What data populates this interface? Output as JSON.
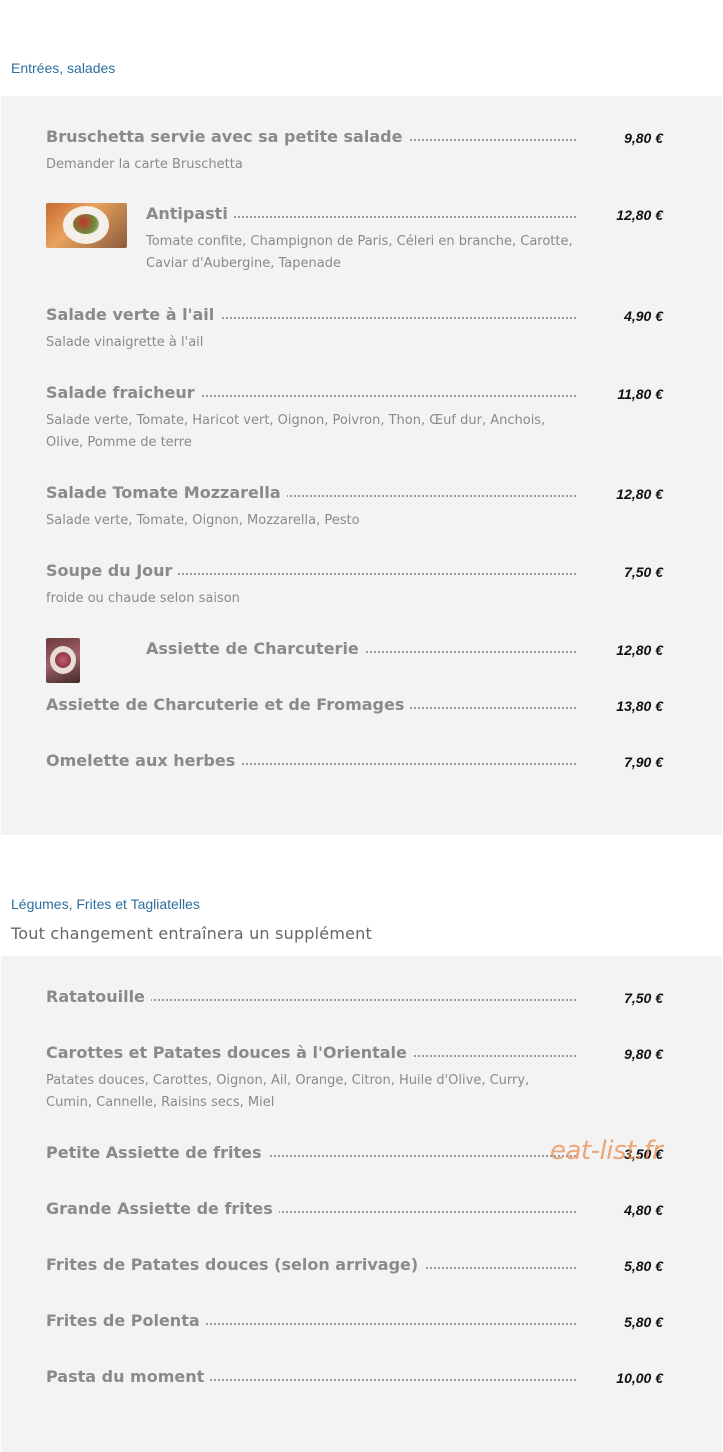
{
  "sections": [
    {
      "title": "Entrées, salades",
      "items": [
        {
          "name": "Bruschetta servie avec sa petite salade",
          "price": "9,80 €",
          "desc": "Demander la carte Bruschetta"
        },
        {
          "name": "Antipasti",
          "price": "12,80 €",
          "desc": "Tomate confite, Champignon de Paris, Céleri en branche, Carotte, Caviar d'Aubergine, Tapenade"
        },
        {
          "name": "Salade verte à l'ail",
          "price": "4,90 €",
          "desc": "Salade vinaigrette à l'ail"
        },
        {
          "name": "Salade fraicheur",
          "price": "11,80 €",
          "desc": "Salade verte, Tomate, Haricot vert, Oignon, Poivron, Thon, Œuf dur, Anchois, Olive, Pomme de terre"
        },
        {
          "name": "Salade Tomate Mozzarella",
          "price": "12,80 €",
          "desc": "Salade verte, Tomate, Oignon, Mozzarella, Pesto"
        },
        {
          "name": "Soupe du Jour",
          "price": "7,50 €",
          "desc": "froide ou chaude selon saison"
        },
        {
          "name": "Assiette de Charcuterie",
          "price": "12,80 €"
        },
        {
          "name": "Assiette de Charcuterie et de Fromages",
          "price": "13,80 €"
        },
        {
          "name": "Omelette aux herbes",
          "price": "7,90 €"
        }
      ]
    },
    {
      "title": "Légumes, Frites et Tagliatelles",
      "note": "Tout changement entraînera un supplément",
      "items": [
        {
          "name": "Ratatouille",
          "price": "7,50 €"
        },
        {
          "name": "Carottes et Patates douces à l'Orientale",
          "price": "9,80 €",
          "desc": "Patates douces, Carottes, Oignon, Ail, Orange, Citron, Huile d'Olive, Curry, Cumin, Cannelle, Raisins secs, Miel"
        },
        {
          "name": "Petite Assiette de frites",
          "price": "3,50 €"
        },
        {
          "name": "Grande Assiette de frites",
          "price": "4,80 €"
        },
        {
          "name": "Frites de Patates douces (selon arrivage)",
          "price": "5,80 €"
        },
        {
          "name": "Frites de Polenta",
          "price": "5,80 €"
        },
        {
          "name": "Pasta du moment",
          "price": "10,00 €"
        }
      ]
    }
  ],
  "watermark": "eat-list.fr"
}
